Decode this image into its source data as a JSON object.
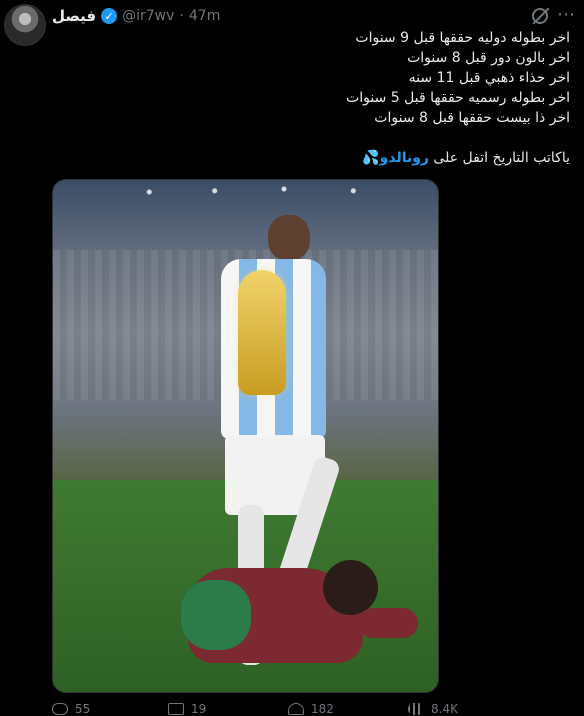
{
  "tweet": {
    "display_name": "فيصل",
    "handle": "@ir7wv",
    "time_separator": "·",
    "time": "47m",
    "lines": [
      "اخر بطوله دوليه حققها قبل 9 سنوات",
      "اخر بالون دور قبل 8 سنوات",
      "اخر حذاء ذهبي قبل 11 سنه",
      "اخر بطوله رسميه حققها قبل 5 سنوات",
      "اخر ذا بيست حققها قبل 8 سنوات"
    ],
    "last_prefix": "ياكاتب التاريخ اتفل على ",
    "mention": "رونالدو",
    "emoji": "💦",
    "actions": {
      "reply": "55",
      "retweet": "19",
      "like": "182",
      "views": "8.4K"
    }
  },
  "icons": {
    "verified": "verified-badge-icon",
    "grok": "grok-icon",
    "more": "more-icon",
    "reply": "reply-icon",
    "retweet": "retweet-icon",
    "like": "like-icon",
    "views": "views-icon"
  },
  "colors": {
    "background": "#000000",
    "text": "#e7e9ea",
    "muted": "#71767b",
    "accent": "#1d9bf0"
  }
}
